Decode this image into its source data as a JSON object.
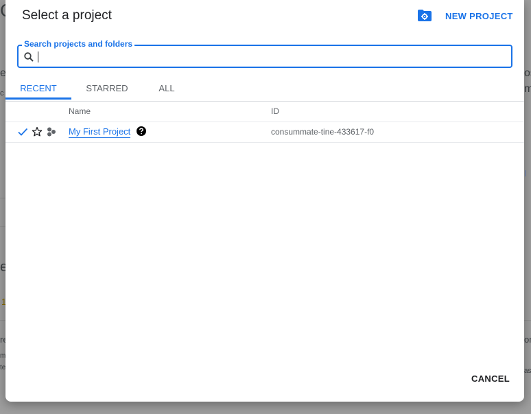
{
  "dialog": {
    "title": "Select a project",
    "new_project_label": "NEW PROJECT",
    "cancel_label": "CANCEL"
  },
  "search": {
    "label": "Search projects and folders",
    "value": ""
  },
  "tabs": [
    {
      "label": "RECENT",
      "active": true
    },
    {
      "label": "STARRED",
      "active": false
    },
    {
      "label": "ALL",
      "active": false
    }
  ],
  "table": {
    "columns": [
      "Name",
      "ID"
    ],
    "rows": [
      {
        "selected": true,
        "starred": false,
        "name": "My First Project",
        "id": "consummate-tine-433617-f0"
      }
    ]
  },
  "colors": {
    "accent": "#1a73e8",
    "text": "#202124",
    "muted": "#5f6368",
    "scrim": "#9e9e9e"
  }
}
